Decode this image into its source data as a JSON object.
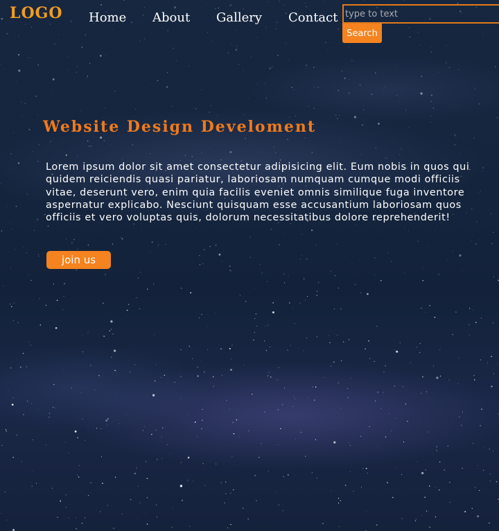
{
  "header": {
    "logo": "LOGO",
    "nav": [
      {
        "label": "Home"
      },
      {
        "label": "About"
      },
      {
        "label": "Gallery"
      },
      {
        "label": "Contact"
      }
    ],
    "search": {
      "placeholder": "type to text",
      "value": "",
      "button_label": "Search"
    }
  },
  "hero": {
    "title": "Website Design Develoment",
    "body": "Lorem ipsum dolor sit amet consectetur adipisicing elit. Eum nobis in quos qui quidem reiciendis quasi pariatur, laboriosam numquam cumque modi officiis vitae, deserunt vero, enim quia facilis eveniet omnis similique fuga inventore aspernatur explicabo. Nesciunt quisquam esse accusantium laboriosam quos officiis et vero voluptas quis, dolorum necessitatibus dolore reprehenderit!",
    "cta_label": "join us"
  },
  "colors": {
    "accent": "#f5831f",
    "logo": "#f39c1f",
    "title": "#f07a1c",
    "text": "#ffffff"
  },
  "icons": []
}
